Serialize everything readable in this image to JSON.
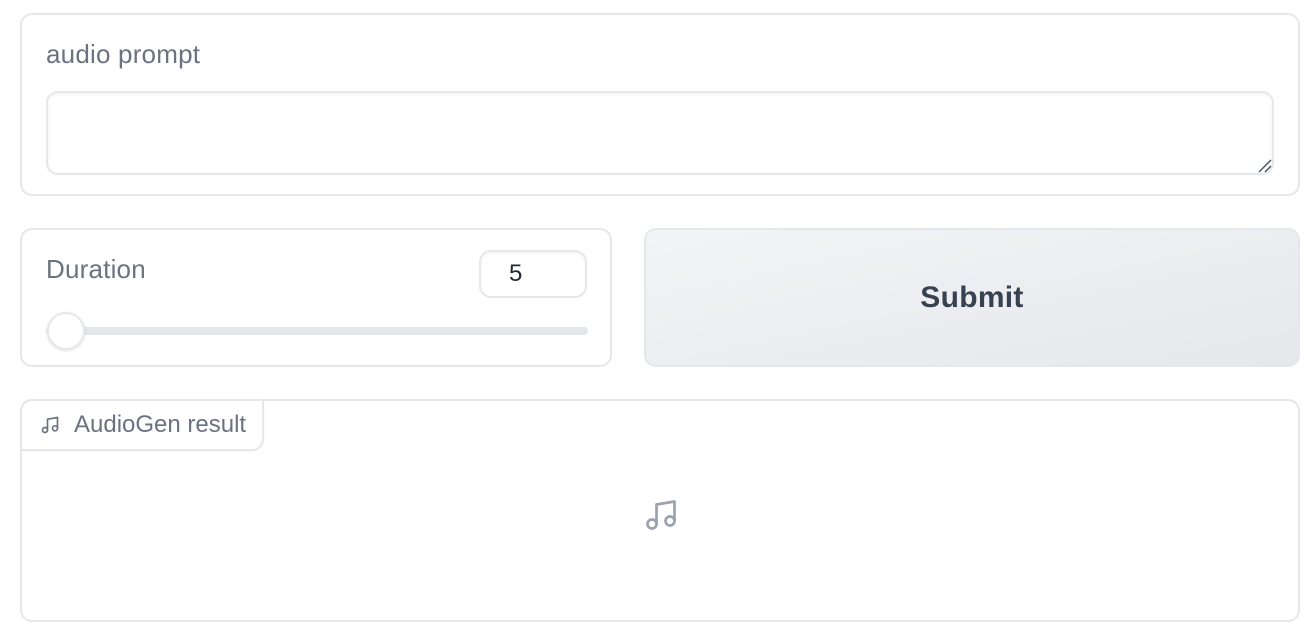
{
  "prompt": {
    "label": "audio prompt",
    "value": "",
    "placeholder": ""
  },
  "duration": {
    "label": "Duration",
    "value": "5",
    "slider_value": 5
  },
  "submit": {
    "label": "Submit"
  },
  "output": {
    "label": "AudioGen result",
    "icon": "music-note-icon"
  },
  "colors": {
    "border": "#e5e7eb",
    "label_text": "#6b7280",
    "button_text": "#374151",
    "button_bg": "#f3f4f6"
  }
}
